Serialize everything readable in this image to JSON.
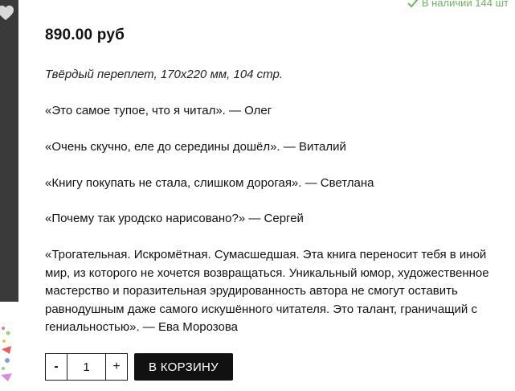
{
  "stock": {
    "text": "В наличии 144 шт",
    "color": "#6fb35f"
  },
  "product": {
    "price": "890.00 руб",
    "format": "Твёрдый переплет, 170х220 мм, 104 стр."
  },
  "reviews": [
    "«Это самое тупое, что я читал». — Олег",
    "«Очень скучно, еле до середины дошёл». — Виталий",
    "«Книгу покупать не стала, слишком дорогая». — Светлана",
    "«Почему так уродско нарисовано?» — Сергей",
    "«Трогательная. Искромётная. Сумасшедшая. Эта книга переносит тебя в иной мир, из которого не хочется возвращаться. Уникальный юмор, художественное мастерство и поразительная эрудированность автора не смогут оставить равнодушным даже самого искушённого читателя. Это талант, граничащий с гениальностью». — Ева Морозова"
  ],
  "cart": {
    "minus_label": "-",
    "quantity": "1",
    "plus_label": "+",
    "add_label": "В КОРЗИНУ"
  },
  "icons": {
    "favorite": "heart-icon",
    "stock": "check-icon"
  }
}
